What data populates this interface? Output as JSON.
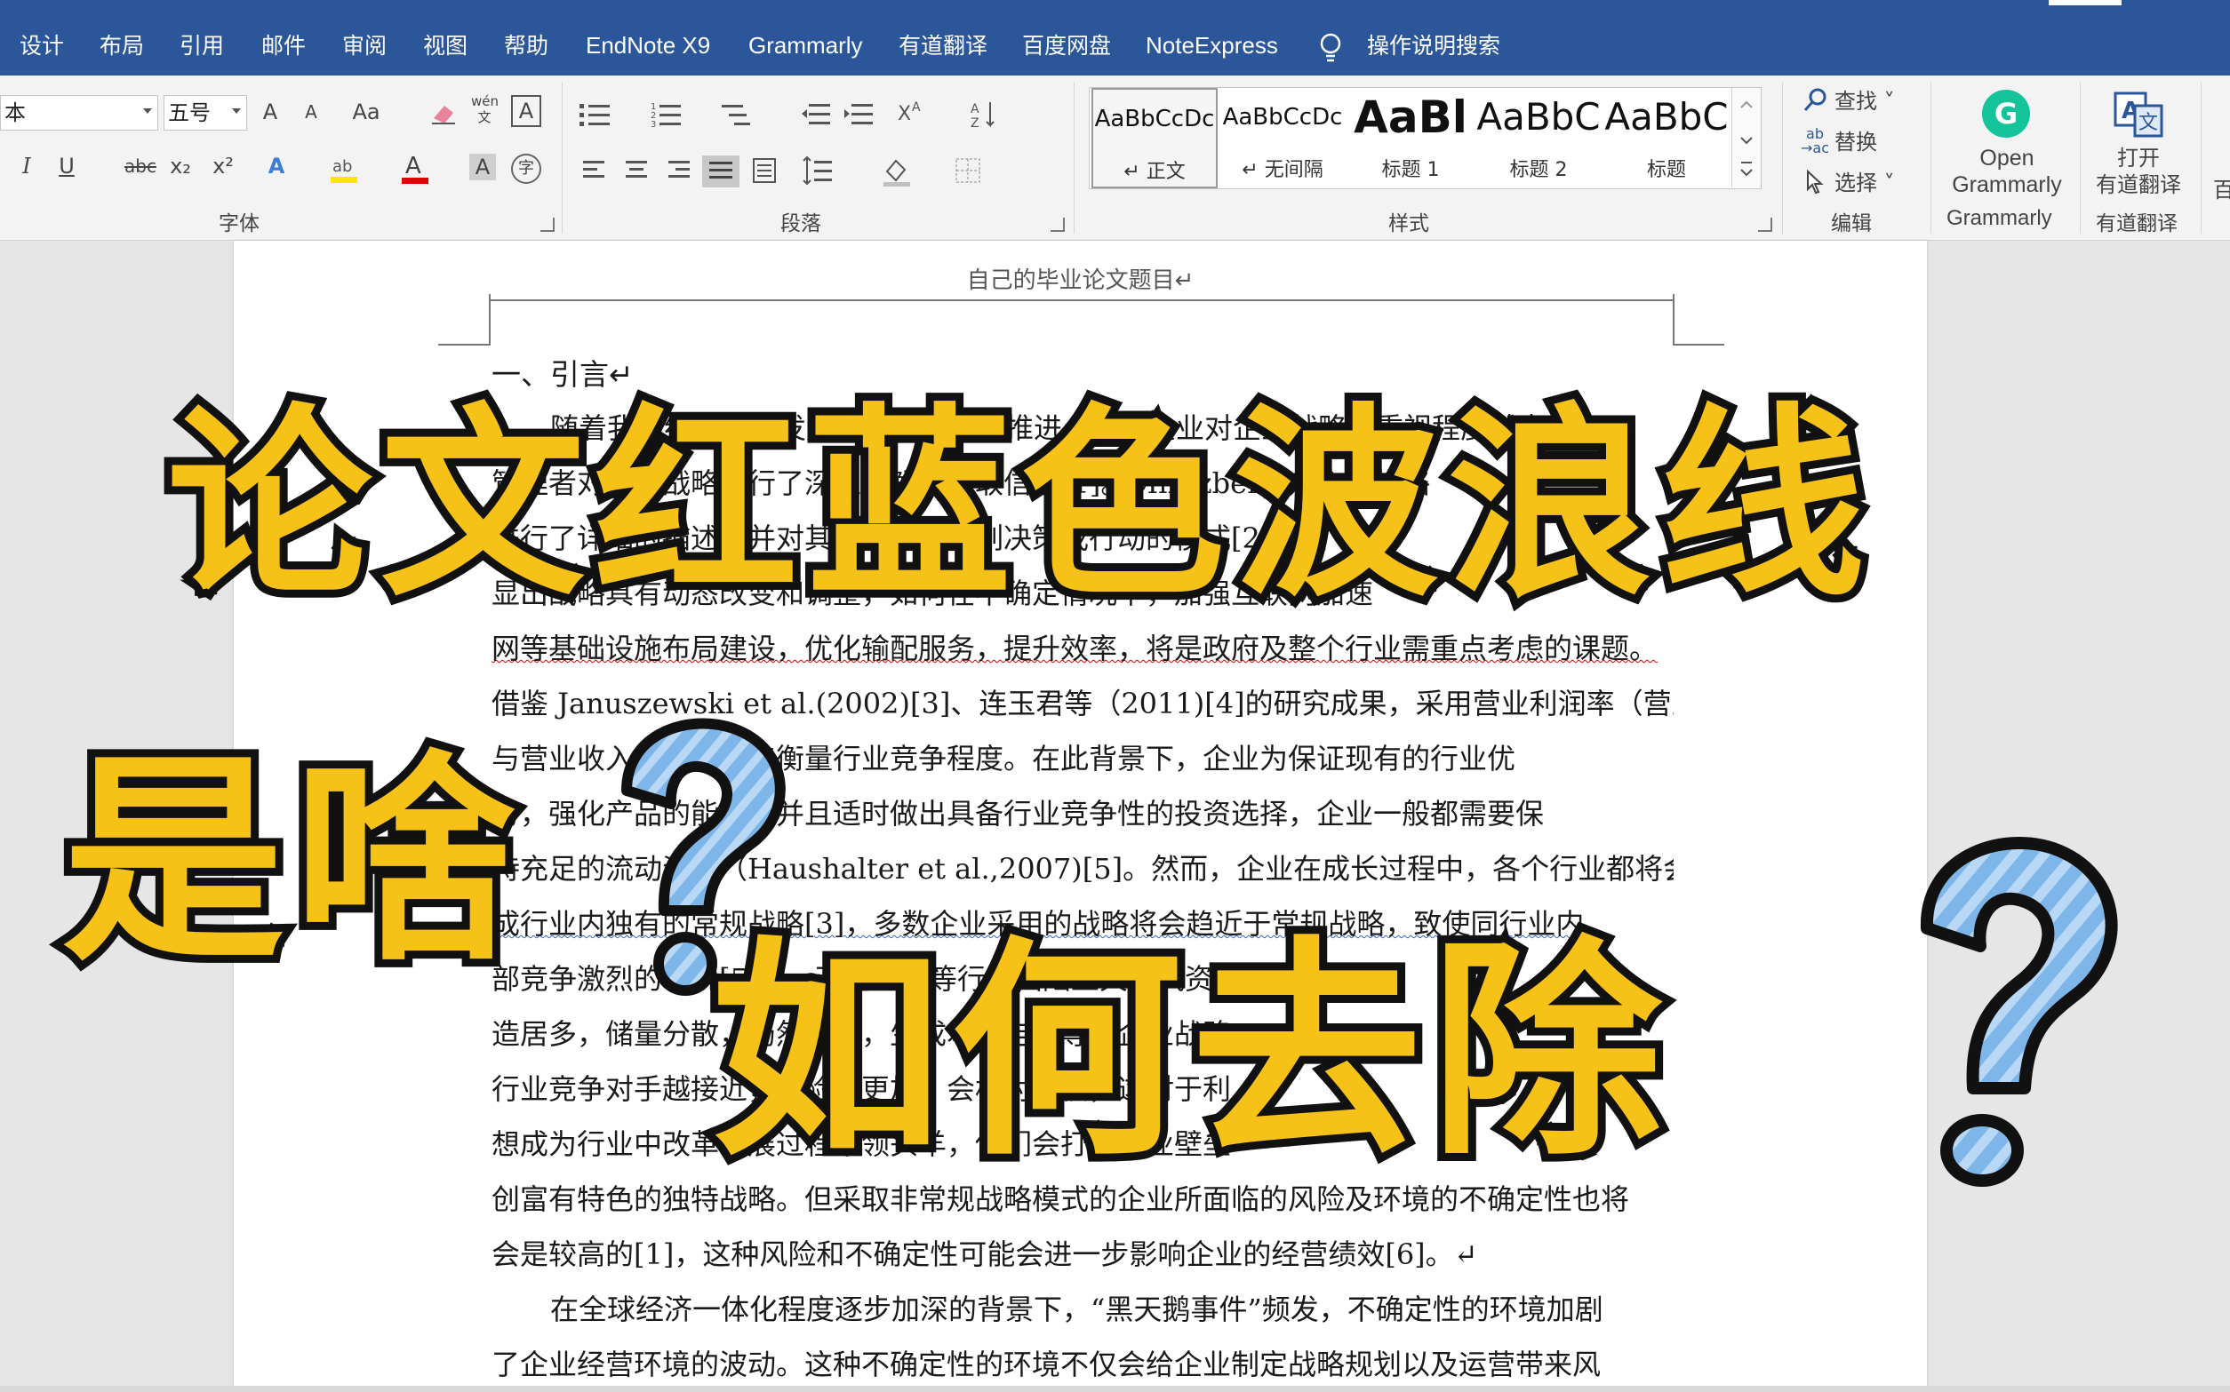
{
  "tabs": [
    "设计",
    "布局",
    "引用",
    "邮件",
    "审阅",
    "视图",
    "帮助",
    "EndNote X9",
    "Grammarly",
    "有道翻译",
    "百度网盘",
    "NoteExpress"
  ],
  "tell_me": "操作说明搜索",
  "ribbon": {
    "font_name": "本",
    "font_size": "五号",
    "groups": {
      "font": "字体",
      "paragraph": "段落",
      "styles": "样式",
      "editing": "编辑",
      "grammarly": "Grammarly",
      "youdao": "有道翻译"
    },
    "styles": [
      {
        "preview": "AaBbCcDc",
        "name": "正文"
      },
      {
        "preview": "AaBbCcDc",
        "name": "无间隔"
      },
      {
        "preview": "AaBl",
        "name": "标题 1"
      },
      {
        "preview": "AaBbC",
        "name": "标题 2"
      },
      {
        "preview": "AaBbC",
        "name": "标题"
      }
    ],
    "editing": {
      "find": "查找",
      "replace": "替换",
      "select": "选择"
    },
    "grammarly_btn": {
      "line1": "Open",
      "line2": "Grammarly"
    },
    "youdao_btn": {
      "line1": "打开",
      "line2": "有道翻译"
    },
    "labels": {
      "bold_i": "I",
      "underline": "U",
      "strike": "abc",
      "sub": "x₂",
      "sup": "x²",
      "font_a": "A",
      "case": "Aa",
      "grow": "A",
      "shrink": "A",
      "pinyin": "wén"
    }
  },
  "document": {
    "header": "自己的毕业论文题目↵",
    "heading": "一、引言↵",
    "lines": [
      "随着我国经济迅速发展以及市场化的推进，上市企业对企业战略的重视程度越来越高，",
      "管理者对企业战略进行了深入了解，获取信息[1]。Mintzberg 对企业战略",
      "进行了详细的描述，并对其定义为一系列决策或行动的模式[2]，凸",
      "显出战略具有动态改变和调整，如何在不确定情况下，加强互联网加速",
      "网等基础设施布局建设，优化输配服务，提升效率，将是政府及整个行业需重点考虑的课题。",
      "借鉴 Januszewski et al.(2002)[3]、连玉君等（2011)[4]的研究成果，采用营业利润率（营业利润",
      "与营业收入的比值）来衡量行业竞争程度。在此背景下，企业为保证现有的行业优",
      "势，强化产品的能力，并且适时做出具备行业竞争性的投资选择，企业一般都需要保",
      "持充足的流动资金（Haushalter et al.,2007)[5]。然而，企业在成长过程中，各个行业都将会形",
      "成行业内独有的常规战略[3]，多数企业采用的战略将会趋近于常规战略，致使同行业内",
      "部竞争激烈的环境[5,7]，石化工用等行业国陆上天然气资源以陆相沉积",
      "造居多，储量分散，仍然稳定，生成本和电力等，企业战略",
      "行业竞争对手越接近，风险会更加，会相对变低，这对于利",
      "想成为行业中改革发展过程中领头羊，他们会打破行业壁垒",
      "创富有特色的独特战略。但采取非常规战略模式的企业所面临的风险及环境的不确定性也将",
      "会是较高的[1]，这种风险和不确定性可能会进一步影响企业的经营绩效[6]。↵",
      "在全球经济一体化程度逐步加深的背景下，“黑天鹅事件”频发，不确定性的环境加剧",
      "了企业经营环境的波动。这种不确定性的环境不仅会给企业制定战略规划以及运营带来风"
    ]
  },
  "overlay": {
    "line1": "论文红蓝色波浪线",
    "line2": "是啥",
    "line3": "如何去除"
  },
  "colors": {
    "tabbar": "#2b579a",
    "overlay_text": "#f6c218",
    "question_mark": "#7fb6ea",
    "squiggle_red": "#d00000",
    "squiggle_blue": "#3367d6"
  }
}
